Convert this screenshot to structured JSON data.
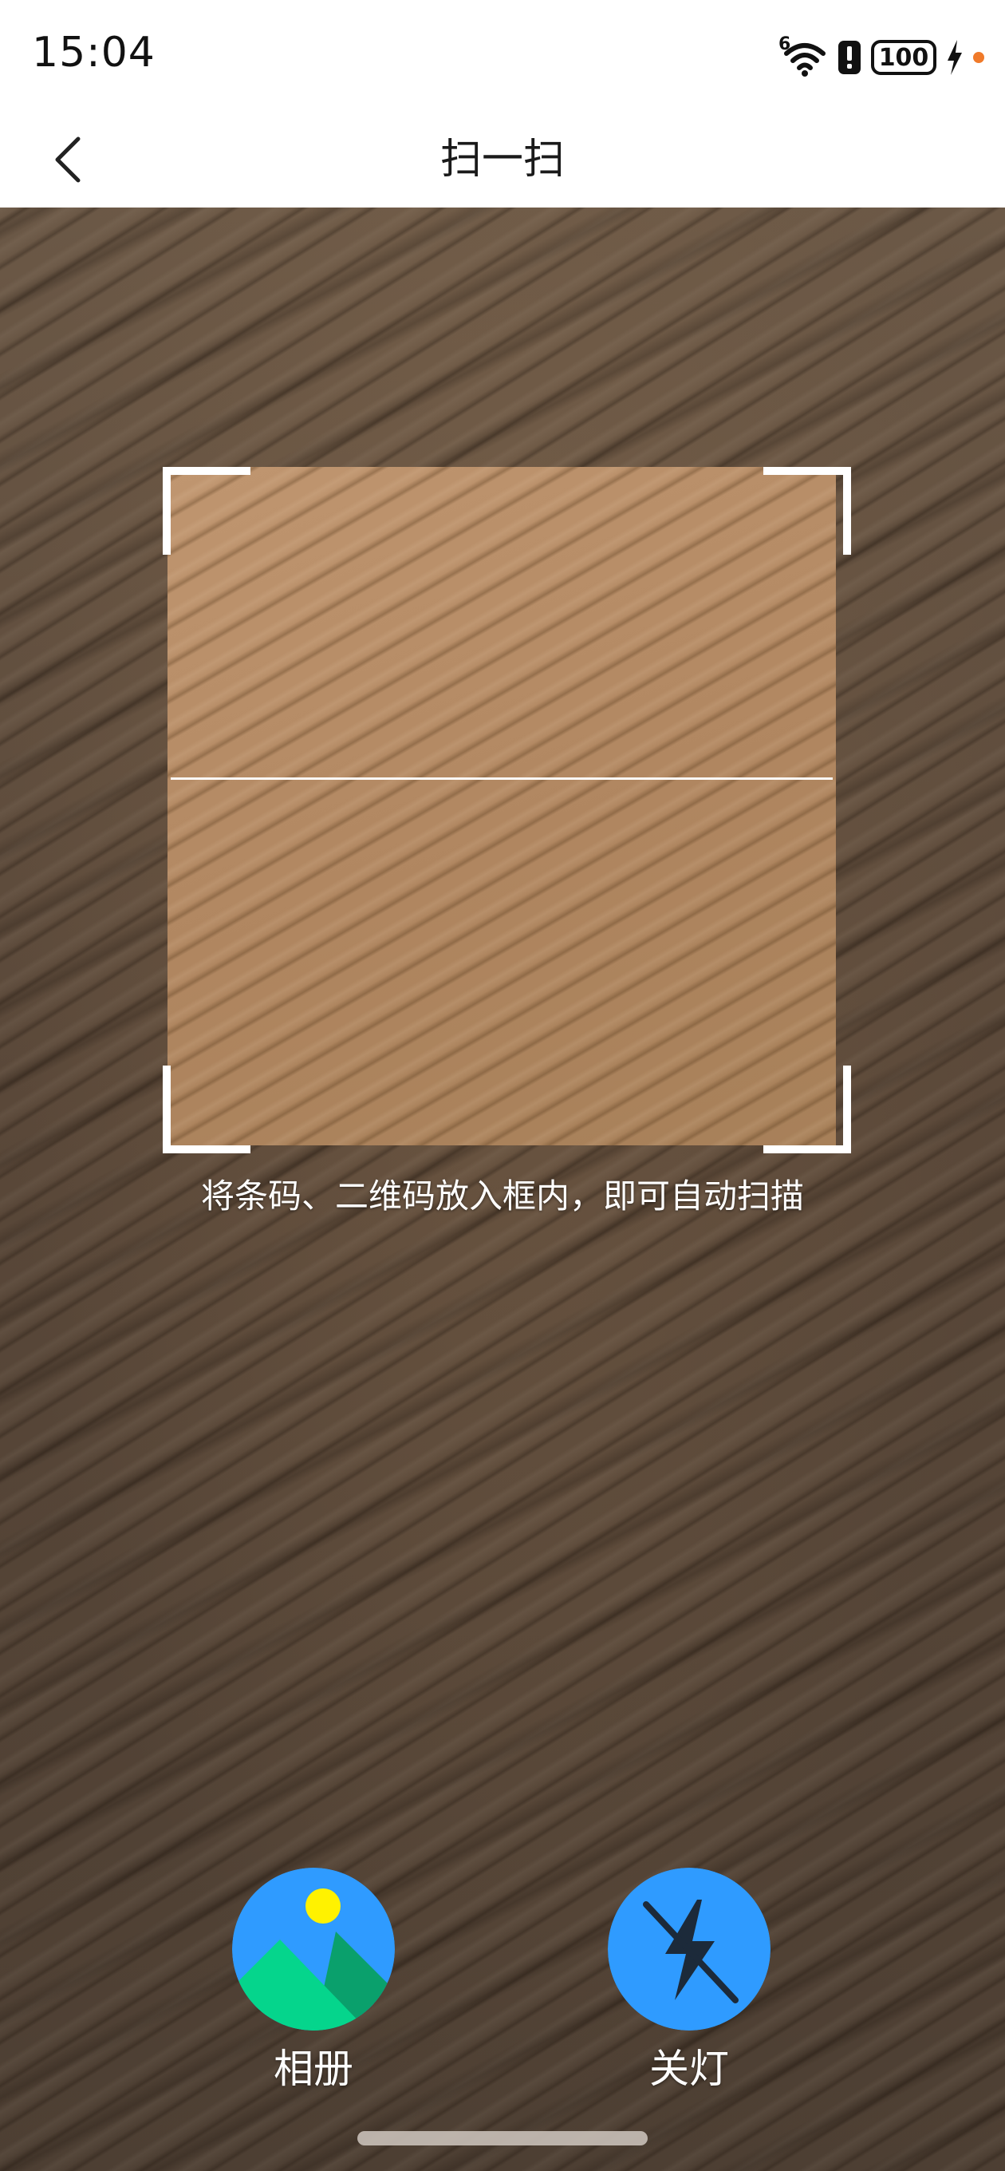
{
  "status_bar": {
    "time": "15:04",
    "network_label": "6",
    "battery": "100"
  },
  "header": {
    "title": "扫一扫"
  },
  "scanner": {
    "hint": "将条码、二维码放入框内，即可自动扫描"
  },
  "controls": {
    "album_label": "相册",
    "light_label": "关灯"
  },
  "colors": {
    "accent_blue": "#2f9bff",
    "album_green": "#05d58c",
    "album_dark_green": "#0aa06c",
    "sun_yellow": "#fff200",
    "charge_dot": "#f07a2a"
  }
}
